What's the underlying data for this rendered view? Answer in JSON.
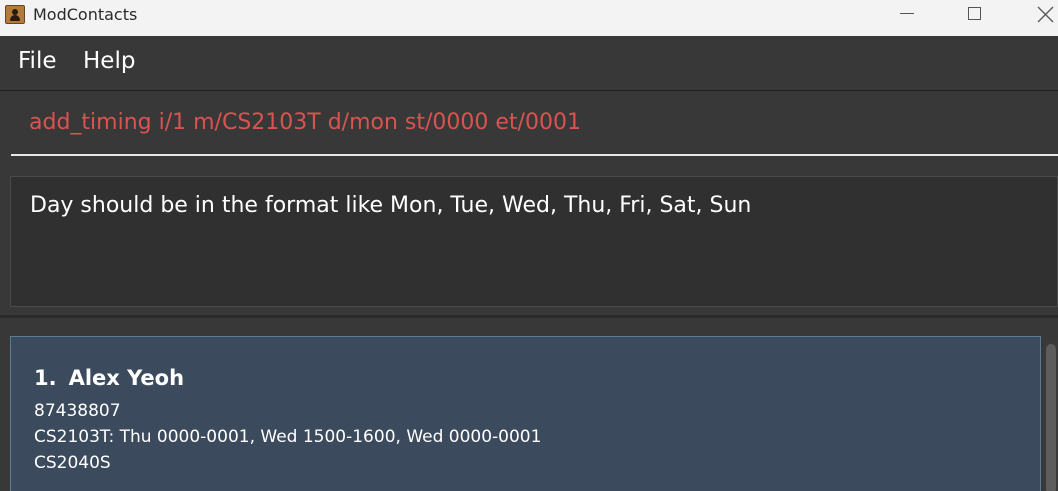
{
  "window": {
    "title": "ModContacts"
  },
  "menu": {
    "file": "File",
    "help": "Help"
  },
  "command": {
    "value": "add_timing i/1 m/CS2103T d/mon st/0000 et/0001"
  },
  "result": {
    "message": "Day should be in the format like Mon, Tue, Wed, Thu, Fri, Sat, Sun"
  },
  "persons": [
    {
      "index": "1.",
      "name": "Alex Yeoh",
      "phone": "87438807",
      "modules": [
        "CS2103T: Thu 0000-0001, Wed 1500-1600, Wed 0000-0001",
        "CS2040S"
      ]
    }
  ],
  "colors": {
    "error_text": "#d9544f",
    "card_background": "#3c4a5e",
    "app_background": "#383838"
  }
}
